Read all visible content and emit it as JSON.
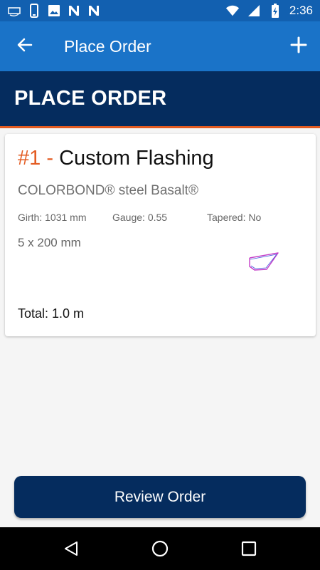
{
  "status_bar": {
    "time": "2:36",
    "notification_icons": [
      "amazon-icon",
      "phone-icon",
      "image-icon",
      "n-app-icon",
      "n-app-icon"
    ],
    "system_icons": [
      "wifi-icon",
      "signal-icon",
      "battery-charging-icon"
    ]
  },
  "app_bar": {
    "title": "Place Order",
    "back_icon": "arrow-left-icon",
    "add_icon": "plus-icon"
  },
  "page_header": {
    "title": "PLACE ORDER"
  },
  "order_item": {
    "number": "#1",
    "separator": "-",
    "name": "Custom Flashing",
    "material": "COLORBOND® steel Basalt®",
    "girth": "Girth: 1031 mm",
    "gauge": "Gauge: 0.55",
    "tapered": "Tapered: No",
    "dimensions": "5 x 200 mm",
    "total": "Total: 1.0 m"
  },
  "review_button": {
    "label": "Review Order"
  },
  "nav_bar": {
    "icons": [
      "triangle-back-icon",
      "circle-home-icon",
      "square-recents-icon"
    ]
  },
  "colors": {
    "status_bar": "#1260b0",
    "app_bar": "#1a73c8",
    "navy": "#052c5e",
    "accent_orange": "#e35b21",
    "background": "#f5f5f5"
  }
}
